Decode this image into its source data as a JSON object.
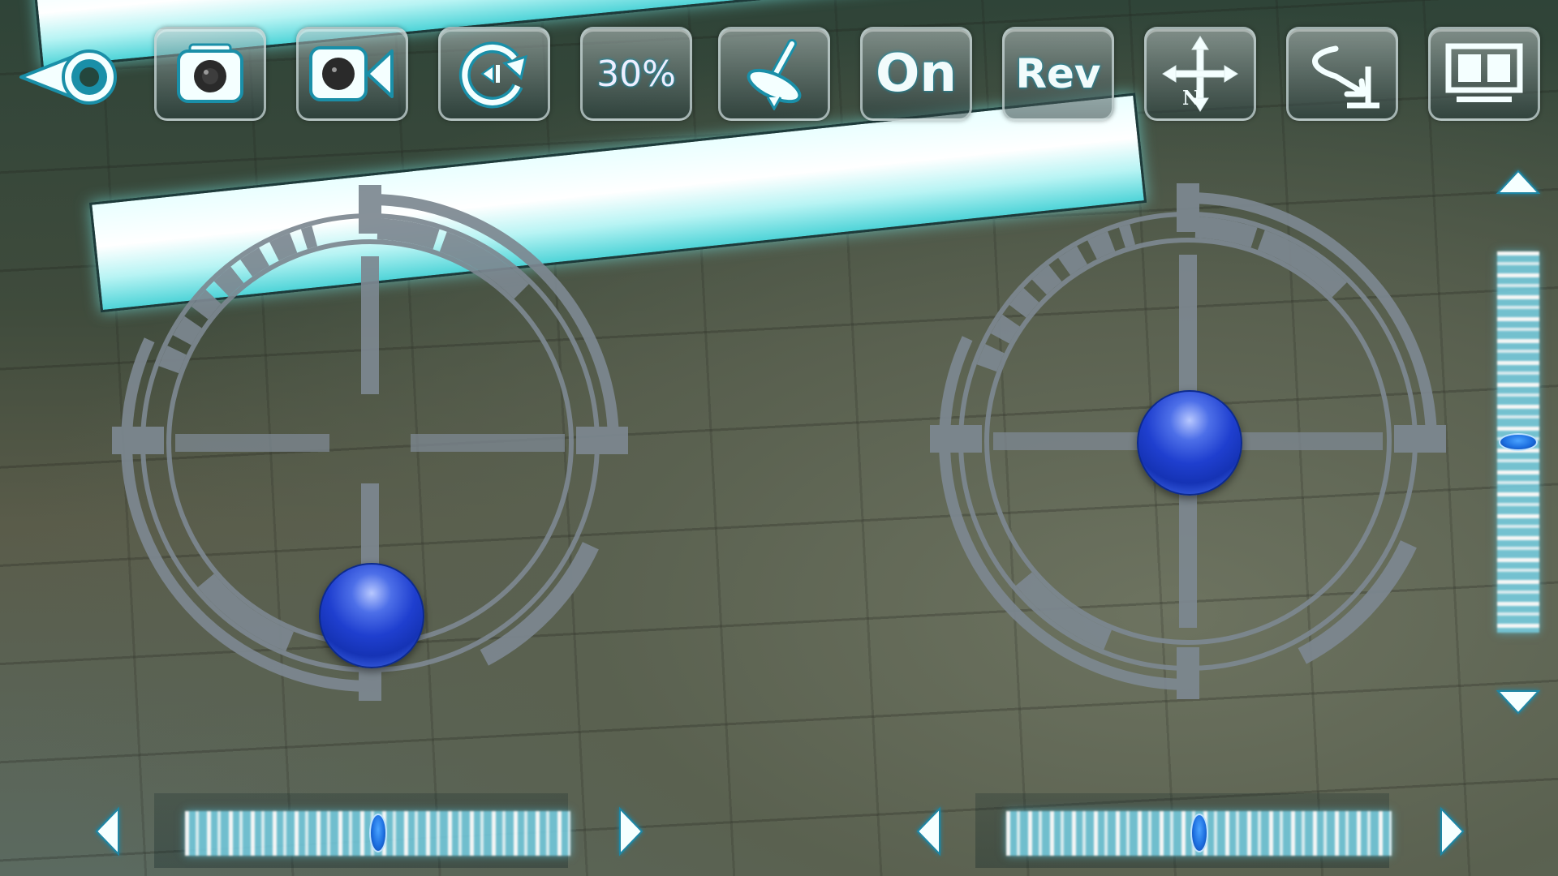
{
  "app": {
    "screen": "drone-flight-control"
  },
  "toolbar": {
    "buttons": [
      {
        "id": "back",
        "icon": "eye-back-icon",
        "label": ""
      },
      {
        "id": "photo",
        "icon": "camera-icon",
        "label": ""
      },
      {
        "id": "video",
        "icon": "video-camera-icon",
        "label": ""
      },
      {
        "id": "rotate",
        "icon": "rotate-icon",
        "label": ""
      },
      {
        "id": "speed",
        "icon": "",
        "label": "30%"
      },
      {
        "id": "gyro",
        "icon": "gyro-calibrate-icon",
        "label": ""
      },
      {
        "id": "power",
        "icon": "",
        "label": "On"
      },
      {
        "id": "reverse",
        "icon": "",
        "label": "Rev"
      },
      {
        "id": "headless",
        "icon": "compass-north-arrows-icon",
        "label": ""
      },
      {
        "id": "return",
        "icon": "return-home-icon",
        "label": ""
      },
      {
        "id": "vr",
        "icon": "split-screen-icon",
        "label": ""
      }
    ]
  },
  "joysticks": {
    "left": {
      "name": "throttle-yaw",
      "x": 0.0,
      "y": -0.85
    },
    "right": {
      "name": "pitch-roll",
      "x": 0.0,
      "y": 0.0
    }
  },
  "trims": {
    "left_horizontal": {
      "value": 0.5
    },
    "right_horizontal": {
      "value": 0.5
    },
    "right_vertical": {
      "value": 0.5
    }
  },
  "colors": {
    "accent": "#1a8fa8",
    "ring": "#7d8891",
    "ball": "#1f3fcf",
    "slider": "#78d2e6"
  }
}
